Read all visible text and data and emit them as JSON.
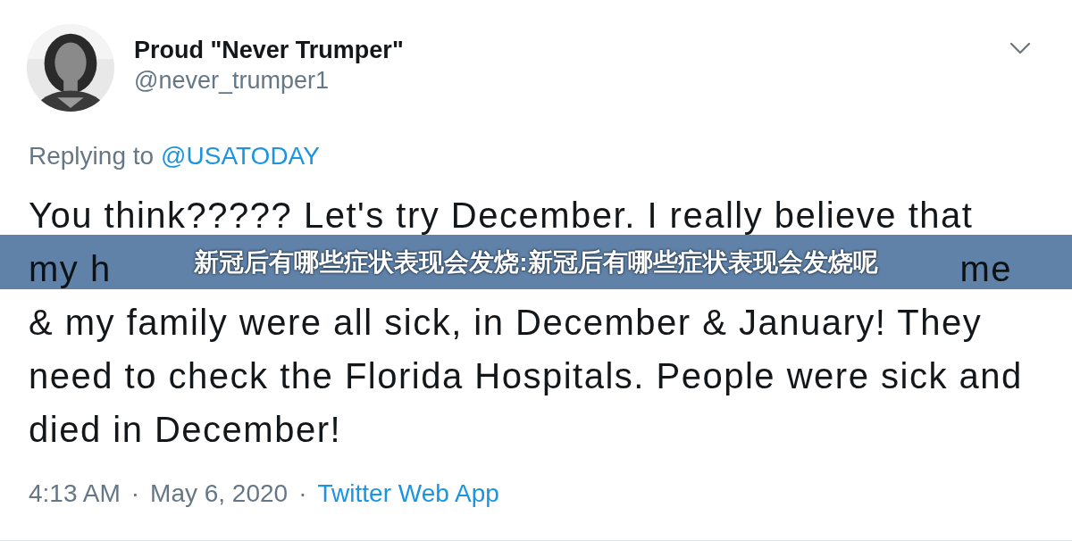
{
  "author": {
    "name": "Proud \"Never Trumper\"",
    "handle": "@never_trumper1"
  },
  "reply": {
    "prefix": "Replying to",
    "mention": "@USATODAY"
  },
  "tweet_lines": [
    {
      "kind": "full",
      "text": "You think????? Let's try December. I really believe that"
    },
    {
      "kind": "split",
      "left": "my h",
      "right": "me"
    },
    {
      "kind": "full",
      "text": "& my family were all sick, in December & January! They"
    },
    {
      "kind": "full",
      "text": "need to check the Florida Hospitals. People were sick and"
    },
    {
      "kind": "full",
      "text": "died in December!"
    }
  ],
  "meta": [
    {
      "kind": "text",
      "text": "4:13 AM"
    },
    {
      "kind": "sep",
      "text": "·"
    },
    {
      "kind": "text",
      "text": "May 6, 2020"
    },
    {
      "kind": "sep",
      "text": "·"
    },
    {
      "kind": "link",
      "text": "Twitter Web App"
    }
  ],
  "banner": {
    "text": "新冠后有哪些症状表现会发烧:新冠后有哪些症状表现会发烧呢"
  }
}
